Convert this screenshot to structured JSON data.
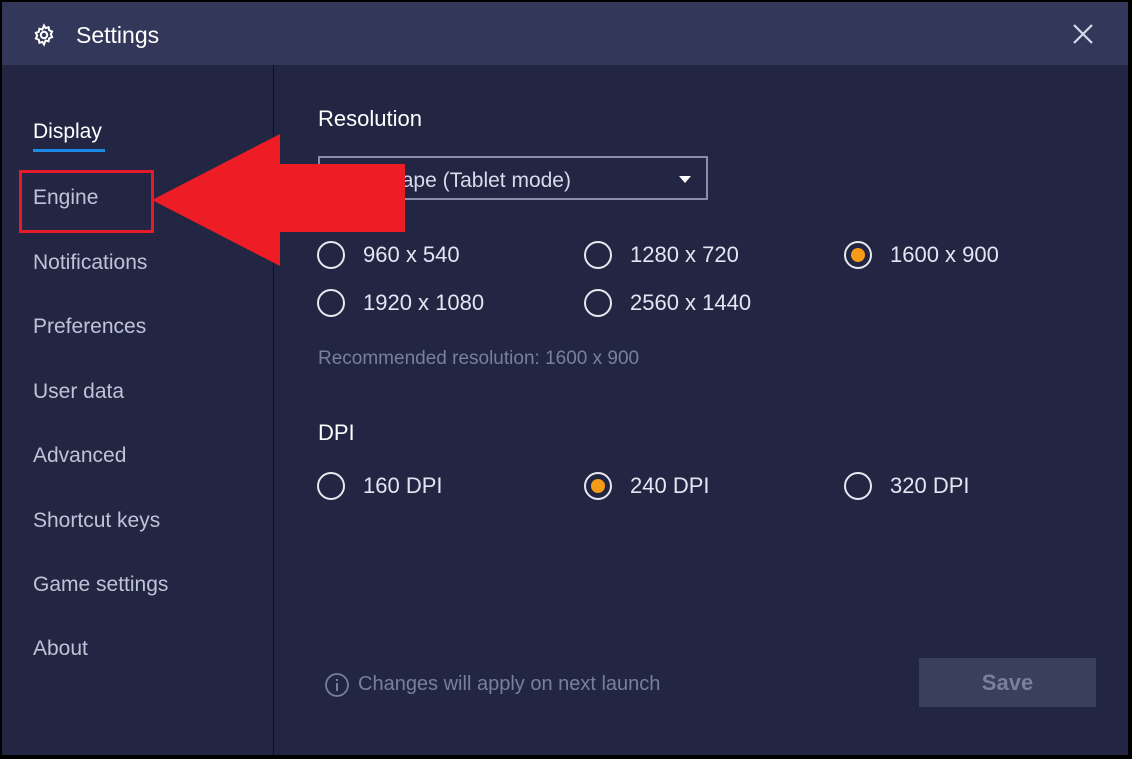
{
  "window": {
    "title": "Settings",
    "close_icon": "close-icon",
    "gear_icon": "gear-icon"
  },
  "sidebar": {
    "items": [
      {
        "label": "Display",
        "active": true
      },
      {
        "label": "Engine",
        "active": false
      },
      {
        "label": "Notifications",
        "active": false
      },
      {
        "label": "Preferences",
        "active": false
      },
      {
        "label": "User data",
        "active": false
      },
      {
        "label": "Advanced",
        "active": false
      },
      {
        "label": "Shortcut keys",
        "active": false
      },
      {
        "label": "Game settings",
        "active": false
      },
      {
        "label": "About",
        "active": false
      }
    ]
  },
  "resolution": {
    "title": "Resolution",
    "dropdown_value": "Landscape (Tablet mode)",
    "options": [
      {
        "label": "960 x 540",
        "checked": false
      },
      {
        "label": "1280 x 720",
        "checked": false
      },
      {
        "label": "1600 x 900",
        "checked": true
      },
      {
        "label": "1920 x 1080",
        "checked": false
      },
      {
        "label": "2560 x 1440",
        "checked": false
      }
    ],
    "recommended": "Recommended resolution: 1600 x 900"
  },
  "dpi": {
    "title": "DPI",
    "options": [
      {
        "label": "160 DPI",
        "checked": false
      },
      {
        "label": "240 DPI",
        "checked": true
      },
      {
        "label": "320 DPI",
        "checked": false
      }
    ]
  },
  "footer": {
    "info_text": "Changes will apply on next launch",
    "save_label": "Save"
  },
  "colors": {
    "background": "#222642",
    "titlebar": "#33385a",
    "accent_underline": "#1f8ae6",
    "radio_checked": "#f59b18",
    "annotation_red": "#e51b2a"
  }
}
